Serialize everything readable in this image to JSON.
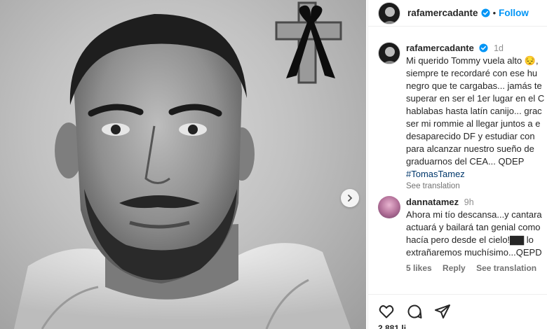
{
  "post": {
    "username": "rafamercadante",
    "follow_label": "Follow",
    "separator": "•"
  },
  "caption": {
    "username": "rafamercadante",
    "time": "1d",
    "lines": [
      "Mi querido Tommy vuela alto 😔,",
      "siempre te recordaré con ese hu",
      "negro que te cargabas... jamás te",
      "superar en ser el 1er lugar en el C",
      "hablabas hasta latín canijo... grac",
      "ser mi rommie al llegar juntos a e",
      "desaparecido DF y estudiar con",
      "para alcanzar nuestro sueño de",
      "graduarnos del CEA... QDEP"
    ],
    "hashtag": "#TomasTamez",
    "see_translation": "See translation"
  },
  "reply": {
    "username": "dannatamez",
    "time": "9h",
    "lines": [
      "Ahora mi tío descansa...y cantara",
      "actuará y bailará tan genial como",
      "hacía pero desde el cielo!▇▇ lo",
      "extrañaremos muchísimo...QEPD"
    ],
    "likes": "5 likes",
    "reply_label": "Reply",
    "see_translation": "See translation"
  },
  "footer": {
    "likes_partial": "2,881 li..."
  },
  "icons": {
    "verified": "verified-badge-icon",
    "next": "chevron-right-icon",
    "like": "heart-icon",
    "comment": "comment-icon",
    "share": "paper-plane-icon",
    "mourning": "mourning-ribbon-cross-icon"
  },
  "colors": {
    "link": "#0095f6",
    "hashtag": "#00376b",
    "muted": "#737373"
  }
}
